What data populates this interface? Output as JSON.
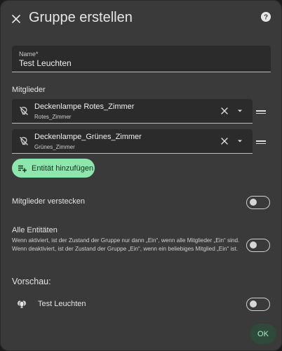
{
  "dialog": {
    "title": "Gruppe erstellen",
    "close_icon": "close-icon",
    "help_icon": "help-circle-icon"
  },
  "name_field": {
    "label": "Name*",
    "value": "Test Leuchten"
  },
  "members": {
    "label": "Mitglieder",
    "items": [
      {
        "name": "Deckenlampe Rotes_Zimmer",
        "sub": "Rotes_Zimmer",
        "icon": "lightbulb-off-icon"
      },
      {
        "name": "Deckenlampe_Grünes_Zimmer",
        "sub": "Grünes_Zimmer",
        "icon": "lightbulb-off-icon"
      }
    ],
    "add_label": "Entität hinzufügen"
  },
  "hide_members": {
    "label": "Mitglieder verstecken",
    "toggle_on": false
  },
  "all_entities": {
    "label": "Alle Entitäten",
    "description": "Wenn aktiviert, ist der Zustand der Gruppe nur dann „Ein“, wenn alle Mitglieder „Ein“ sind. Wenn deaktiviert, ist der Zustand der Gruppe „Ein“, wenn ein beliebiges Mitglied „Ein“ ist.",
    "toggle_on": false
  },
  "preview": {
    "label": "Vorschau:",
    "entity_name": "Test Leuchten",
    "icon": "lightbulb-group-icon",
    "toggle_on": false
  },
  "ok_label": "OK",
  "colors": {
    "accent": "#8fe6ad",
    "dialog_bg": "#3a3a3a",
    "field_bg": "#2b2b2b"
  }
}
